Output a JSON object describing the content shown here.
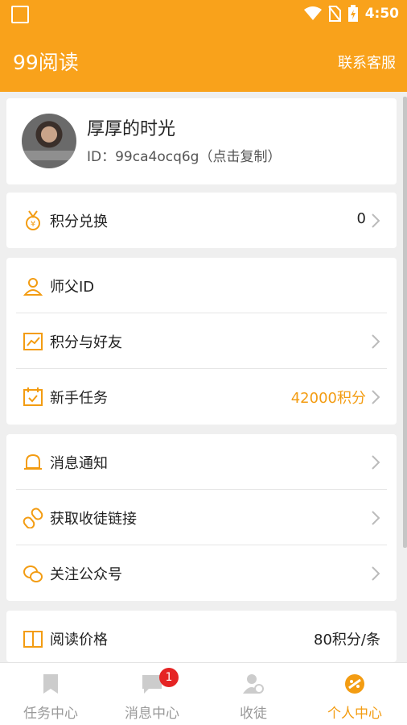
{
  "status_bar": {
    "time": "4:50"
  },
  "app_bar": {
    "title": "99阅读",
    "contact_label": "联系客服"
  },
  "profile": {
    "name": "厚厚的时光",
    "id_text": "ID：99ca4ocq6g（点击复制）"
  },
  "menu": {
    "points_exchange": {
      "label": "积分兑换",
      "value": "0"
    },
    "master_id": {
      "label": "师父ID"
    },
    "points_friends": {
      "label": "积分与好友"
    },
    "newbie_tasks": {
      "label": "新手任务",
      "value": "42000积分"
    },
    "message_notice": {
      "label": "消息通知"
    },
    "recruit_link": {
      "label": "获取收徒链接"
    },
    "follow_account": {
      "label": "关注公众号"
    },
    "read_price": {
      "label": "阅读价格",
      "value": "80积分/条"
    }
  },
  "tabs": [
    {
      "label": "任务中心",
      "icon": "bookmark-icon"
    },
    {
      "label": "消息中心",
      "icon": "chat-icon",
      "badge": "1"
    },
    {
      "label": "收徒",
      "icon": "person-add-icon"
    },
    {
      "label": "个人中心",
      "icon": "profile-icon"
    }
  ],
  "colors": {
    "accent": "#f9a21b",
    "text_orange": "#f39c12",
    "badge": "#e52424"
  }
}
